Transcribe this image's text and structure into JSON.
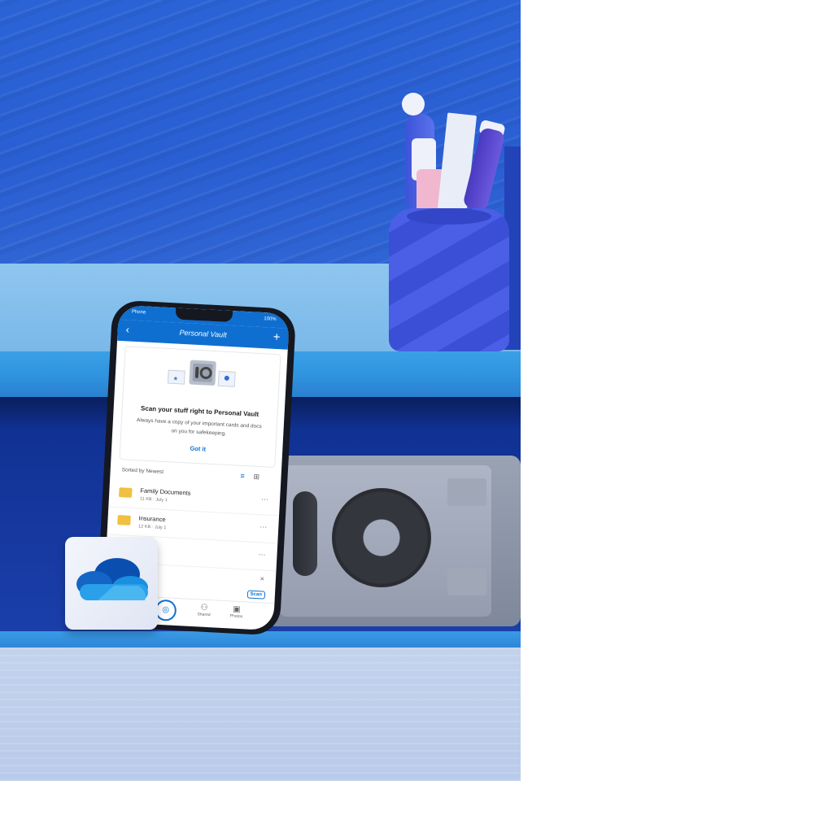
{
  "phone": {
    "status_carrier": "Phone",
    "status_battery": "100%",
    "nav_title": "Personal Vault",
    "nav_back_icon": "chevron-left-icon",
    "nav_add_icon": "plus-icon",
    "card": {
      "title": "Scan your stuff right to Personal Vault",
      "body": "Always have a copy of your important cards and docs on you for safekeeping.",
      "button": "Got it"
    },
    "sort_label": "Sorted by Newest",
    "files": [
      {
        "name": "Family Documents",
        "meta": "11 KB · July 1"
      },
      {
        "name": "Insurance",
        "meta": "12 KB · July 1"
      }
    ],
    "scan_label": "Scan",
    "tabs": [
      {
        "label": "Shared",
        "icon": "people-icon"
      },
      {
        "label": "Photos",
        "icon": "photo-icon"
      }
    ]
  },
  "colors": {
    "wall": "#2b63d6",
    "shelf": "#3aa0e6",
    "cubby": "#14369b",
    "accent": "#0e6fd1"
  }
}
